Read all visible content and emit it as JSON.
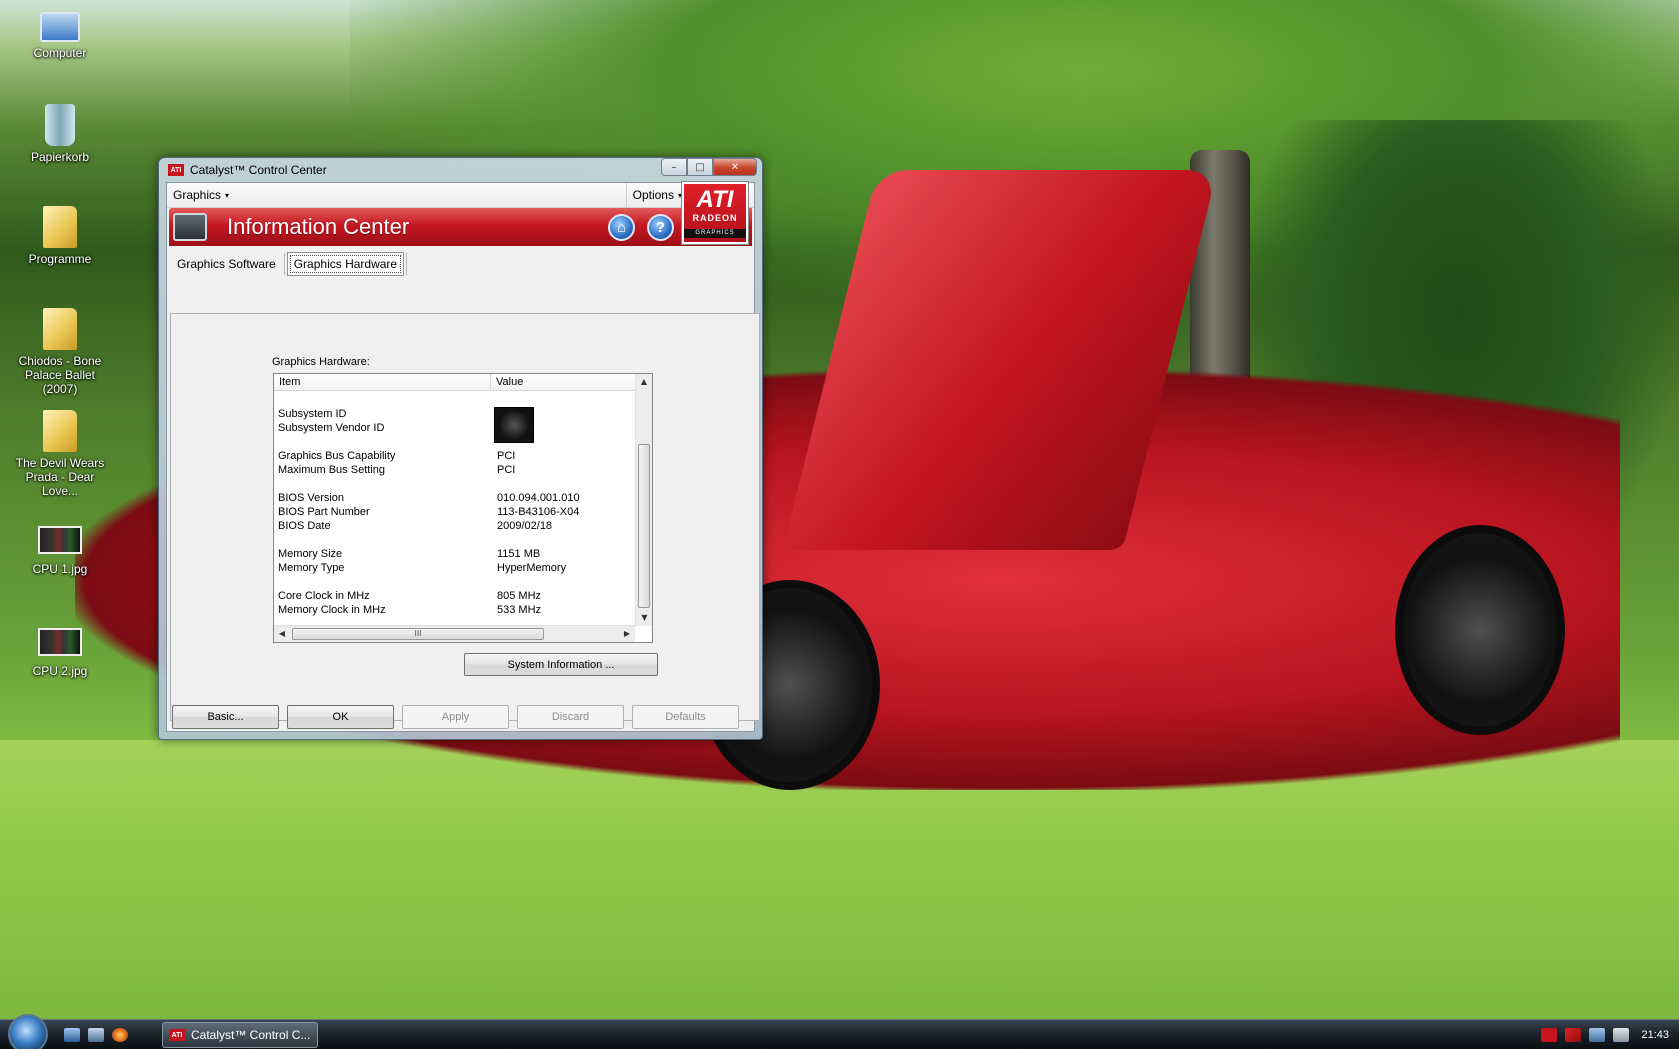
{
  "desktop": {
    "icons": [
      {
        "label": "Computer",
        "icon": "computer-icon"
      },
      {
        "label": "Papierkorb",
        "icon": "recycle-bin-icon"
      },
      {
        "label": "Programme",
        "icon": "folder-icon"
      },
      {
        "label": "Chiodos - Bone Palace Ballet (2007)",
        "icon": "folder-icon"
      },
      {
        "label": "The Devil Wears Prada - Dear Love...",
        "icon": "folder-icon"
      },
      {
        "label": "CPU 1.jpg",
        "icon": "image-file-icon"
      },
      {
        "label": "CPU 2.jpg",
        "icon": "image-file-icon"
      }
    ]
  },
  "window": {
    "title": "Catalyst™ Control Center",
    "logo_text": "ATI",
    "controls": {
      "minimize": "–",
      "maximize": "□",
      "close": "✕"
    }
  },
  "menubar": {
    "graphics": "Graphics",
    "options": "Options",
    "caret": "▾"
  },
  "banner": {
    "title": "Information Center",
    "home_icon": "⌂",
    "help_icon": "?",
    "brand": {
      "ati": "ATI",
      "radeon": "RADEON",
      "graphics": "GRAPHICS"
    }
  },
  "tabs": {
    "software": "Graphics Software",
    "hardware": "Graphics Hardware",
    "active": "hardware"
  },
  "hardware": {
    "section_label": "Graphics Hardware:",
    "columns": {
      "item": "Item",
      "value": "Value"
    },
    "rows": [
      {
        "item": "Subsystem ID",
        "value": ""
      },
      {
        "item": "Subsystem Vendor ID",
        "value": ""
      },
      {
        "item": "Graphics Bus Capability",
        "value": "PCI"
      },
      {
        "item": "Maximum Bus Setting",
        "value": "PCI"
      },
      {
        "item": "BIOS Version",
        "value": "010.094.001.010"
      },
      {
        "item": "BIOS Part Number",
        "value": "113-B43106-X04"
      },
      {
        "item": "BIOS Date",
        "value": "2009/02/18"
      },
      {
        "item": "Memory Size",
        "value": "1151 MB"
      },
      {
        "item": "Memory Type",
        "value": "HyperMemory"
      },
      {
        "item": "Core Clock in MHz",
        "value": "805 MHz"
      },
      {
        "item": "Memory Clock in MHz",
        "value": "533 MHz"
      }
    ],
    "scroll": {
      "up": "▲",
      "down": "▼",
      "left": "◀",
      "right": "▶",
      "grip": "III",
      "vgrip": "≡"
    },
    "system_info_button": "System Information ..."
  },
  "footer_buttons": {
    "basic": "Basic...",
    "ok": "OK",
    "apply": "Apply",
    "discard": "Discard",
    "defaults": "Defaults"
  },
  "taskbar": {
    "task_label": "Catalyst™ Control C...",
    "task_logo": "ATI",
    "clock": "21:43"
  }
}
